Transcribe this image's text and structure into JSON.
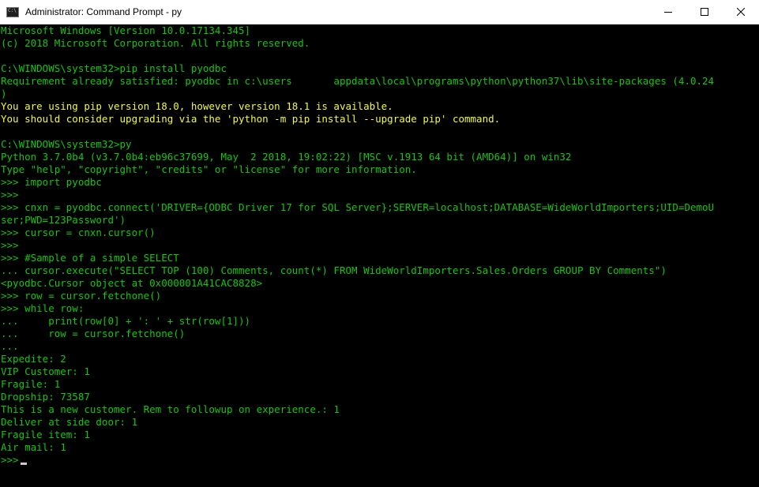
{
  "window": {
    "title": "Administrator: Command Prompt - py",
    "icon": "cmd-icon",
    "controls": [
      "minimize-icon",
      "maximize-icon",
      "close-icon"
    ]
  },
  "colors": {
    "green": "#16c60c",
    "yellow": "#f1fa3a",
    "white": "#cccccc",
    "background": "#000000"
  },
  "console": {
    "lines": [
      {
        "text": "Microsoft Windows [Version 10.0.17134.345]",
        "color": "green"
      },
      {
        "text": "(c) 2018 Microsoft Corporation. All rights reserved.",
        "color": "green"
      },
      {
        "text": "",
        "color": "green"
      },
      {
        "text": "C:\\WINDOWS\\system32>pip install pyodbc",
        "color": "green"
      },
      {
        "text": "Requirement already satisfied: pyodbc in c:\\users       appdata\\local\\programs\\python\\python37\\lib\\site-packages (4.0.24",
        "color": "green"
      },
      {
        "text": ")",
        "color": "green"
      },
      {
        "text": "You are using pip version 18.0, however version 18.1 is available.",
        "color": "yellow"
      },
      {
        "text": "You should consider upgrading via the 'python -m pip install --upgrade pip' command.",
        "color": "yellow"
      },
      {
        "text": "",
        "color": "green"
      },
      {
        "text": "C:\\WINDOWS\\system32>py",
        "color": "green"
      },
      {
        "text": "Python 3.7.0b4 (v3.7.0b4:eb96c37699, May  2 2018, 19:02:22) [MSC v.1913 64 bit (AMD64)] on win32",
        "color": "green"
      },
      {
        "text": "Type \"help\", \"copyright\", \"credits\" or \"license\" for more information.",
        "color": "green"
      },
      {
        "text": ">>> import pyodbc",
        "color": "green"
      },
      {
        "text": ">>>",
        "color": "green"
      },
      {
        "text": ">>> cnxn = pyodbc.connect('DRIVER={ODBC Driver 17 for SQL Server};SERVER=localhost;DATABASE=WideWorldImporters;UID=DemoU",
        "color": "green"
      },
      {
        "text": "ser;PWD=123Password')",
        "color": "green"
      },
      {
        "text": ">>> cursor = cnxn.cursor()",
        "color": "green"
      },
      {
        "text": ">>>",
        "color": "green"
      },
      {
        "text": ">>> #Sample of a simple SELECT",
        "color": "green"
      },
      {
        "text": "... cursor.execute(\"SELECT TOP (100) Comments, count(*) FROM WideWorldImporters.Sales.Orders GROUP BY Comments\")",
        "color": "green"
      },
      {
        "text": "<pyodbc.Cursor object at 0x000001A41CAC8828>",
        "color": "green"
      },
      {
        "text": ">>> row = cursor.fetchone()",
        "color": "green"
      },
      {
        "text": ">>> while row:",
        "color": "green"
      },
      {
        "text": "...     print(row[0] + ': ' + str(row[1]))",
        "color": "green"
      },
      {
        "text": "...     row = cursor.fetchone()",
        "color": "green"
      },
      {
        "text": "...",
        "color": "green"
      },
      {
        "text": "Expedite: 2",
        "color": "green"
      },
      {
        "text": "VIP Customer: 1",
        "color": "green"
      },
      {
        "text": "Fragile: 1",
        "color": "green"
      },
      {
        "text": "Dropship: 73587",
        "color": "green"
      },
      {
        "text": "This is a new customer. Rem to followup on experience.: 1",
        "color": "green"
      },
      {
        "text": "Deliver at side door: 1",
        "color": "green"
      },
      {
        "text": "Fragile item: 1",
        "color": "green"
      },
      {
        "text": "Air mail: 1",
        "color": "green"
      }
    ],
    "prompt": ">>>"
  }
}
